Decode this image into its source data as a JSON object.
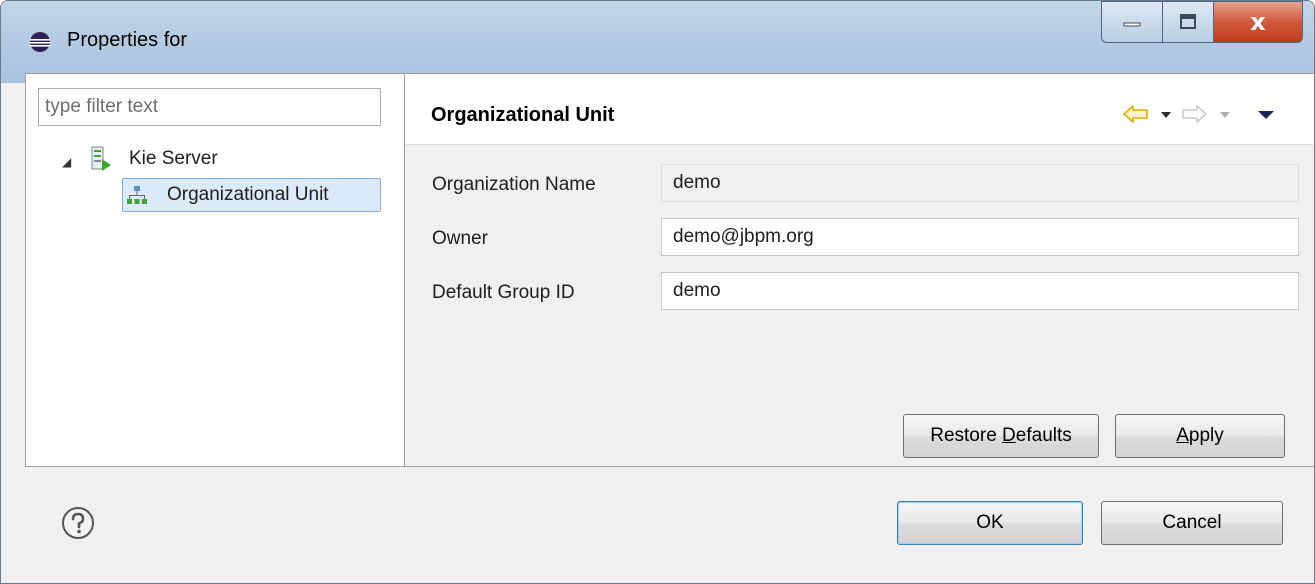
{
  "window": {
    "title": "Properties for",
    "close_glyph": "x"
  },
  "filter": {
    "placeholder": "type filter text",
    "value": ""
  },
  "tree": {
    "root": {
      "label": "Kie Server",
      "icon": "kie-server-icon",
      "expanded": true
    },
    "children": [
      {
        "label": "Organizational Unit",
        "icon": "org-unit-icon",
        "selected": true
      }
    ]
  },
  "page": {
    "title": "Organizational Unit",
    "fields": [
      {
        "label": "Organization Name",
        "value": "demo",
        "readonly": true
      },
      {
        "label": "Owner",
        "value": "demo@jbpm.org",
        "readonly": false
      },
      {
        "label": "Default Group ID",
        "value": "demo",
        "readonly": false
      }
    ],
    "restore_defaults": {
      "prefix": "Restore ",
      "mnemonic": "D",
      "suffix": "efaults"
    },
    "apply": {
      "prefix": "",
      "mnemonic": "A",
      "suffix": "pply"
    }
  },
  "footer": {
    "ok_label": "OK",
    "cancel_label": "Cancel"
  },
  "colors": {
    "selection": "#dbeaf9",
    "nav_arrow": "#e8a800",
    "title_bar": "#b4cbe3",
    "close_button": "#c8472a"
  }
}
